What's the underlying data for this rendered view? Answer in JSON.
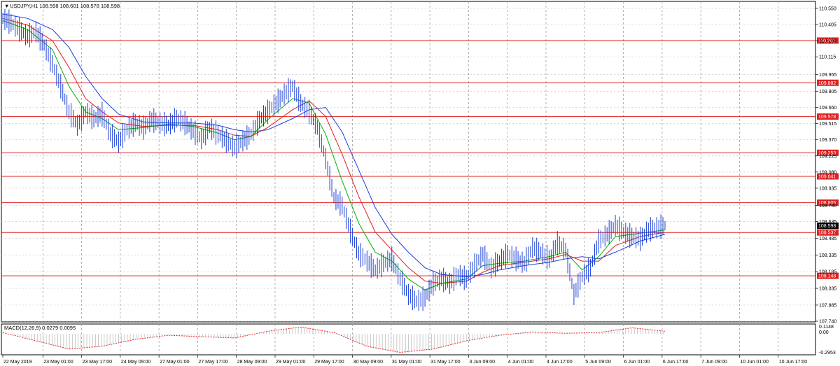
{
  "header": {
    "symbol_menu": "▼",
    "symbol_info": "USDJPY,H1  108.598 108.601 108.578 108.598"
  },
  "macd": {
    "label": "MACD(12,26,9) 0.0279 0.0095",
    "ticks": [
      "0.1148",
      "0.00",
      "-0.2953"
    ]
  },
  "chart_data": {
    "type": "line",
    "title": "",
    "xlabel": "",
    "ylabel": "",
    "ylim": [
      107.74,
      110.55
    ],
    "y_ticks": [
      "110.550",
      "110.405",
      "110.260",
      "110.115",
      "109.955",
      "109.805",
      "109.660",
      "109.515",
      "109.370",
      "109.225",
      "109.080",
      "108.935",
      "108.780",
      "108.635",
      "108.485",
      "108.335",
      "108.185",
      "108.035",
      "107.885",
      "107.740"
    ],
    "x_ticks": [
      "22 May 2019",
      "23 May 01:00",
      "23 May 17:00",
      "24 May 09:00",
      "27 May 01:00",
      "27 May 17:00",
      "28 May 09:00",
      "29 May 01:00",
      "29 May 17:00",
      "30 May 09:00",
      "31 May 01:00",
      "31 May 17:00",
      "3 Jun 09:00",
      "4 Jun 01:00",
      "4 Jun 17:00",
      "5 Jun 09:00",
      "6 Jun 01:00",
      "6 Jun 17:00",
      "7 Jun 09:00",
      "10 Jun 01:00",
      "10 Jun 17:00"
    ],
    "levels": [
      "110.261",
      "109.882",
      "109.578",
      "109.253",
      "109.041",
      "108.805",
      "108.537",
      "108.148"
    ],
    "current_price": "108.598",
    "level_color": "#e02020",
    "candle_color": "#1a3fd6",
    "ma_colors": [
      "#00b000",
      "#e02020",
      "#1a3fd6"
    ],
    "price_path": [
      [
        0,
        110.46
      ],
      [
        1,
        110.42
      ],
      [
        2,
        110.36
      ],
      [
        3,
        110.3
      ],
      [
        4,
        110.34
      ],
      [
        5,
        110.22
      ],
      [
        6,
        110.05
      ],
      [
        7,
        109.85
      ],
      [
        8,
        109.62
      ],
      [
        9,
        109.5
      ],
      [
        10,
        109.62
      ],
      [
        11,
        109.56
      ],
      [
        12,
        109.6
      ],
      [
        13,
        109.42
      ],
      [
        14,
        109.35
      ],
      [
        15,
        109.46
      ],
      [
        16,
        109.52
      ],
      [
        17,
        109.48
      ],
      [
        18,
        109.55
      ],
      [
        19,
        109.52
      ],
      [
        20,
        109.5
      ],
      [
        21,
        109.56
      ],
      [
        22,
        109.52
      ],
      [
        23,
        109.45
      ],
      [
        24,
        109.38
      ],
      [
        25,
        109.48
      ],
      [
        26,
        109.42
      ],
      [
        27,
        109.36
      ],
      [
        28,
        109.3
      ],
      [
        29,
        109.36
      ],
      [
        30,
        109.42
      ],
      [
        31,
        109.55
      ],
      [
        32,
        109.62
      ],
      [
        33,
        109.7
      ],
      [
        34,
        109.78
      ],
      [
        35,
        109.85
      ],
      [
        36,
        109.7
      ],
      [
        37,
        109.62
      ],
      [
        38,
        109.48
      ],
      [
        39,
        109.2
      ],
      [
        40,
        108.85
      ],
      [
        41,
        108.78
      ],
      [
        42,
        108.55
      ],
      [
        43,
        108.35
      ],
      [
        44,
        108.28
      ],
      [
        45,
        108.2
      ],
      [
        46,
        108.26
      ],
      [
        47,
        108.3
      ],
      [
        48,
        108.12
      ],
      [
        49,
        107.98
      ],
      [
        50,
        107.92
      ],
      [
        51,
        107.95
      ],
      [
        52,
        108.08
      ],
      [
        53,
        108.12
      ],
      [
        54,
        108.08
      ],
      [
        55,
        108.16
      ],
      [
        56,
        108.12
      ],
      [
        57,
        108.24
      ],
      [
        58,
        108.34
      ],
      [
        59,
        108.22
      ],
      [
        60,
        108.28
      ],
      [
        61,
        108.34
      ],
      [
        62,
        108.3
      ],
      [
        63,
        108.26
      ],
      [
        64,
        108.4
      ],
      [
        65,
        108.36
      ],
      [
        66,
        108.3
      ],
      [
        67,
        108.44
      ],
      [
        68,
        108.38
      ],
      [
        69,
        107.98
      ],
      [
        70,
        108.14
      ],
      [
        71,
        108.22
      ],
      [
        72,
        108.46
      ],
      [
        73,
        108.52
      ],
      [
        74,
        108.6
      ],
      [
        75,
        108.54
      ],
      [
        76,
        108.5
      ],
      [
        77,
        108.48
      ],
      [
        78,
        108.56
      ],
      [
        79,
        108.58
      ],
      [
        80,
        108.6
      ]
    ],
    "ma_fast": [
      [
        0,
        110.44
      ],
      [
        3,
        110.36
      ],
      [
        6,
        110.18
      ],
      [
        8,
        109.85
      ],
      [
        10,
        109.62
      ],
      [
        12,
        109.56
      ],
      [
        14,
        109.46
      ],
      [
        17,
        109.48
      ],
      [
        20,
        109.51
      ],
      [
        23,
        109.49
      ],
      [
        26,
        109.43
      ],
      [
        28,
        109.37
      ],
      [
        30,
        109.4
      ],
      [
        32,
        109.55
      ],
      [
        35,
        109.74
      ],
      [
        37,
        109.7
      ],
      [
        39,
        109.42
      ],
      [
        41,
        109.0
      ],
      [
        43,
        108.62
      ],
      [
        45,
        108.36
      ],
      [
        47,
        108.28
      ],
      [
        49,
        108.12
      ],
      [
        51,
        108.02
      ],
      [
        53,
        108.08
      ],
      [
        56,
        108.12
      ],
      [
        58,
        108.24
      ],
      [
        60,
        108.26
      ],
      [
        63,
        108.28
      ],
      [
        66,
        108.32
      ],
      [
        68,
        108.36
      ],
      [
        70,
        108.2
      ],
      [
        72,
        108.32
      ],
      [
        74,
        108.5
      ],
      [
        77,
        108.53
      ],
      [
        80,
        108.56
      ]
    ],
    "ma_mid": [
      [
        0,
        110.46
      ],
      [
        3,
        110.4
      ],
      [
        6,
        110.26
      ],
      [
        8,
        110.02
      ],
      [
        10,
        109.74
      ],
      [
        12,
        109.62
      ],
      [
        14,
        109.52
      ],
      [
        17,
        109.49
      ],
      [
        20,
        109.5
      ],
      [
        23,
        109.5
      ],
      [
        26,
        109.46
      ],
      [
        28,
        109.41
      ],
      [
        30,
        109.4
      ],
      [
        32,
        109.48
      ],
      [
        35,
        109.64
      ],
      [
        37,
        109.72
      ],
      [
        39,
        109.58
      ],
      [
        41,
        109.24
      ],
      [
        43,
        108.86
      ],
      [
        45,
        108.54
      ],
      [
        47,
        108.38
      ],
      [
        49,
        108.22
      ],
      [
        51,
        108.1
      ],
      [
        53,
        108.08
      ],
      [
        56,
        108.1
      ],
      [
        58,
        108.18
      ],
      [
        60,
        108.24
      ],
      [
        63,
        108.27
      ],
      [
        66,
        108.3
      ],
      [
        68,
        108.34
      ],
      [
        70,
        108.28
      ],
      [
        72,
        108.28
      ],
      [
        74,
        108.42
      ],
      [
        77,
        108.5
      ],
      [
        80,
        108.54
      ]
    ],
    "ma_slow": [
      [
        0,
        110.5
      ],
      [
        3,
        110.46
      ],
      [
        6,
        110.36
      ],
      [
        8,
        110.2
      ],
      [
        10,
        109.94
      ],
      [
        12,
        109.74
      ],
      [
        14,
        109.6
      ],
      [
        17,
        109.53
      ],
      [
        20,
        109.52
      ],
      [
        23,
        109.52
      ],
      [
        26,
        109.5
      ],
      [
        28,
        109.46
      ],
      [
        30,
        109.44
      ],
      [
        32,
        109.46
      ],
      [
        35,
        109.56
      ],
      [
        37,
        109.64
      ],
      [
        39,
        109.66
      ],
      [
        41,
        109.44
      ],
      [
        43,
        109.1
      ],
      [
        45,
        108.76
      ],
      [
        47,
        108.52
      ],
      [
        49,
        108.36
      ],
      [
        51,
        108.22
      ],
      [
        53,
        108.16
      ],
      [
        56,
        108.14
      ],
      [
        58,
        108.16
      ],
      [
        60,
        108.2
      ],
      [
        63,
        108.24
      ],
      [
        66,
        108.27
      ],
      [
        68,
        108.3
      ],
      [
        70,
        108.32
      ],
      [
        72,
        108.3
      ],
      [
        74,
        108.36
      ],
      [
        77,
        108.46
      ],
      [
        80,
        108.52
      ]
    ],
    "macd_signal": [
      [
        0,
        0.02
      ],
      [
        4,
        -0.1
      ],
      [
        8,
        -0.22
      ],
      [
        12,
        -0.18
      ],
      [
        16,
        -0.08
      ],
      [
        20,
        -0.02
      ],
      [
        24,
        -0.04
      ],
      [
        28,
        -0.06
      ],
      [
        32,
        0.04
      ],
      [
        36,
        0.1
      ],
      [
        40,
        0.02
      ],
      [
        44,
        -0.18
      ],
      [
        48,
        -0.27
      ],
      [
        52,
        -0.22
      ],
      [
        56,
        -0.1
      ],
      [
        60,
        -0.02
      ],
      [
        64,
        0.03
      ],
      [
        68,
        0.01
      ],
      [
        72,
        0.02
      ],
      [
        76,
        0.09
      ],
      [
        80,
        0.04
      ]
    ]
  }
}
